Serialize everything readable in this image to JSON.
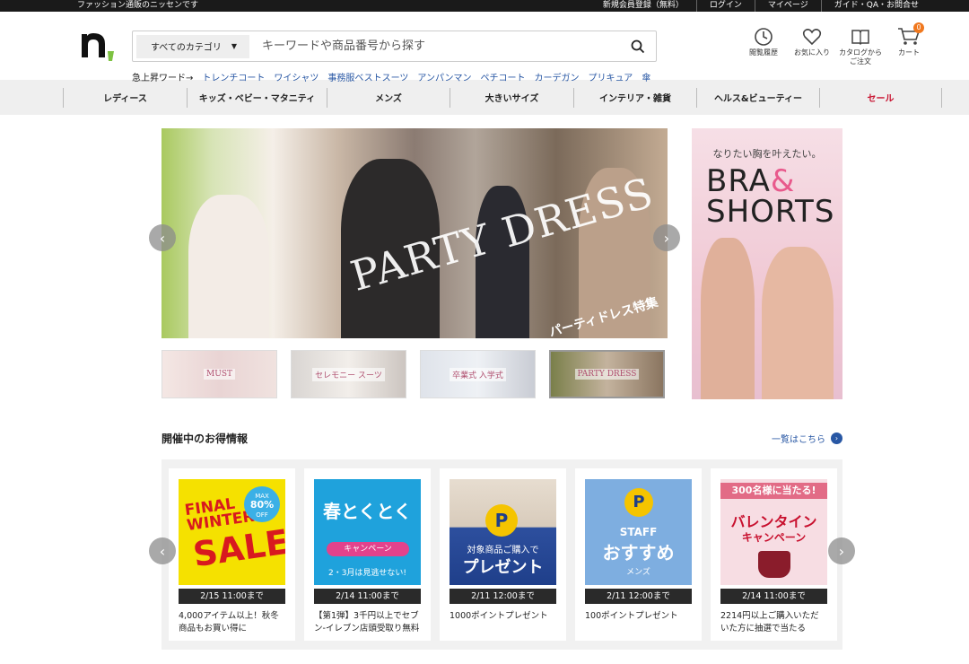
{
  "topbar": {
    "tagline": "ファッション通販のニッセンです",
    "links": [
      "新規会員登録（無料）",
      "ログイン",
      "マイページ",
      "ガイド・QA・お問合せ"
    ]
  },
  "search": {
    "category": "すべてのカテゴリ",
    "placeholder": "キーワードや商品番号から探す"
  },
  "trend": {
    "label": "急上昇ワード→",
    "words": [
      "トレンチコート",
      "ワイシャツ",
      "事務服ベストスーツ",
      "アンパンマン",
      "ペチコート",
      "カーデガン",
      "プリキュア",
      "傘"
    ]
  },
  "header_icons": {
    "history": "閲覧履歴",
    "favorites": "お気に入り",
    "catalog_line1": "カタログから",
    "catalog_line2": "ご注文",
    "cart": "カート",
    "cart_count": "0"
  },
  "nav": [
    "レディース",
    "キッズ・ベビー・マタニティ",
    "メンズ",
    "大きいサイズ",
    "インテリア・雑貨",
    "ヘルス&ビューティー",
    "セール"
  ],
  "banner": {
    "title": "PARTY DRESS",
    "subtitle": "パーティドレス特集",
    "thumbs": [
      "MUST",
      "セレモニー スーツ",
      "卒業式 入学式",
      "PARTY DRESS"
    ]
  },
  "side_ad": {
    "tagline": "なりたい胸を叶えたい。",
    "title_a": "BRA",
    "amp": "&",
    "title_b": "SHORTS"
  },
  "deals": {
    "heading": "開催中のお得情報",
    "see_all": "一覧はこちら",
    "items": [
      {
        "img_a": "FINAL",
        "img_b": "WINTER",
        "img_c": "SALE",
        "badge_a": "MAX",
        "badge_b": "80%",
        "badge_c": "OFF",
        "date": "2/15 11:00まで",
        "desc": "4,000アイテム以上！秋冬商品もお買い得に"
      },
      {
        "img_a": "春とくとく",
        "img_b": "キャンペーン",
        "img_c": "2・3月は見逃せない!",
        "date": "2/14 11:00まで",
        "desc": "【第1弾】3千円以上でセブン-イレブン店頭受取り無料"
      },
      {
        "img_a": "対象商品ご購入で",
        "img_b": "プレゼント",
        "img_c": "P",
        "date": "2/11 12:00まで",
        "desc": "1000ポイントプレゼント"
      },
      {
        "img_a": "STAFF",
        "img_b": "おすすめ",
        "img_c": "メンズ",
        "date": "2/11 12:00まで",
        "desc": "100ポイントプレゼント"
      },
      {
        "img_a": "300名様に当たる!",
        "img_b": "バレンタイン",
        "img_c": "キャンペーン",
        "date": "2/14 11:00まで",
        "desc": "2214円以上ご購入いただいた方に抽選で当たる"
      }
    ]
  },
  "colors": {
    "topbar": "#1a1a1a",
    "link": "#2857a4",
    "sale": "#c8102e",
    "accent_green": "#7dc242",
    "cart_badge": "#f0781e"
  }
}
